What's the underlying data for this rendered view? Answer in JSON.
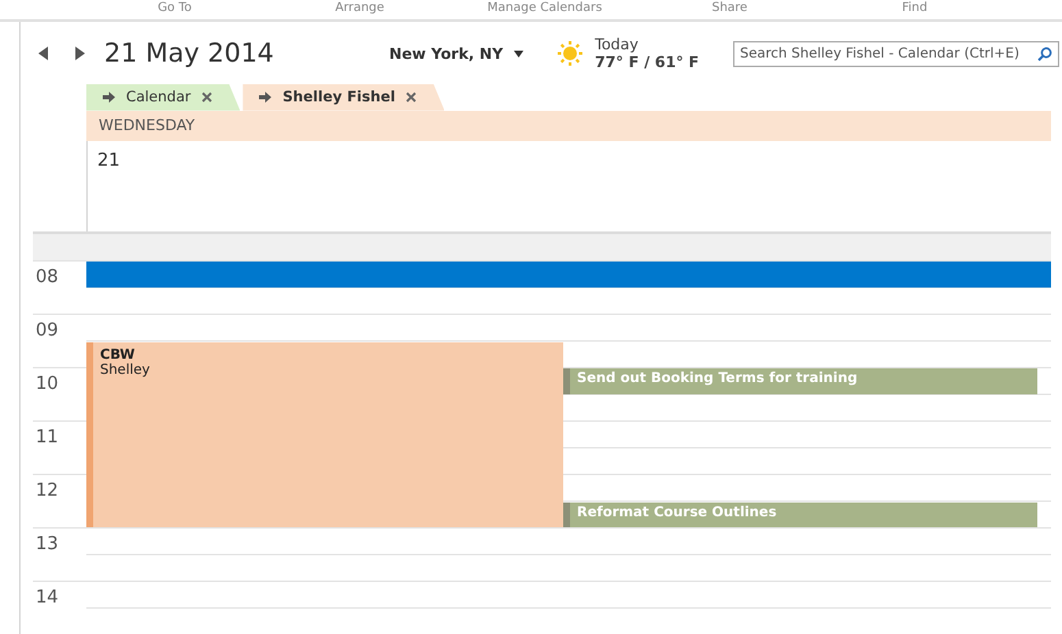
{
  "ribbon_groups": [
    "Go To",
    "Arrange",
    "Manage Calendars",
    "Share",
    "Find"
  ],
  "header": {
    "date": "21 May 2014",
    "location": "New York, NY",
    "weather": {
      "label": "Today",
      "temps": "77° F / 61° F"
    },
    "search": {
      "placeholder": "Search Shelley Fishel - Calendar (Ctrl+E)"
    }
  },
  "tabs": [
    {
      "label": "Calendar",
      "selected": false,
      "color": "#d9efc9"
    },
    {
      "label": "Shelley Fishel",
      "selected": true,
      "color": "#fbe3d0"
    }
  ],
  "day": {
    "weekday": "WEDNESDAY",
    "date": "21"
  },
  "hours": [
    {
      "label": "08",
      "events": [
        {
          "kind": "busy",
          "half_past": false
        }
      ]
    },
    {
      "label": "09",
      "events": [
        {
          "kind": "appointment",
          "half_past": true,
          "title": "CBW",
          "organizer": "Shelley"
        }
      ]
    },
    {
      "label": "10",
      "events": [
        {
          "kind": "task",
          "half_past": false,
          "title": "Send out Booking Terms for training"
        }
      ]
    },
    {
      "label": "11"
    },
    {
      "label": "12",
      "events": [
        {
          "kind": "task",
          "half_past": true,
          "title": "Reformat Course Outlines"
        }
      ]
    },
    {
      "label": "13"
    },
    {
      "label": "14"
    }
  ]
}
